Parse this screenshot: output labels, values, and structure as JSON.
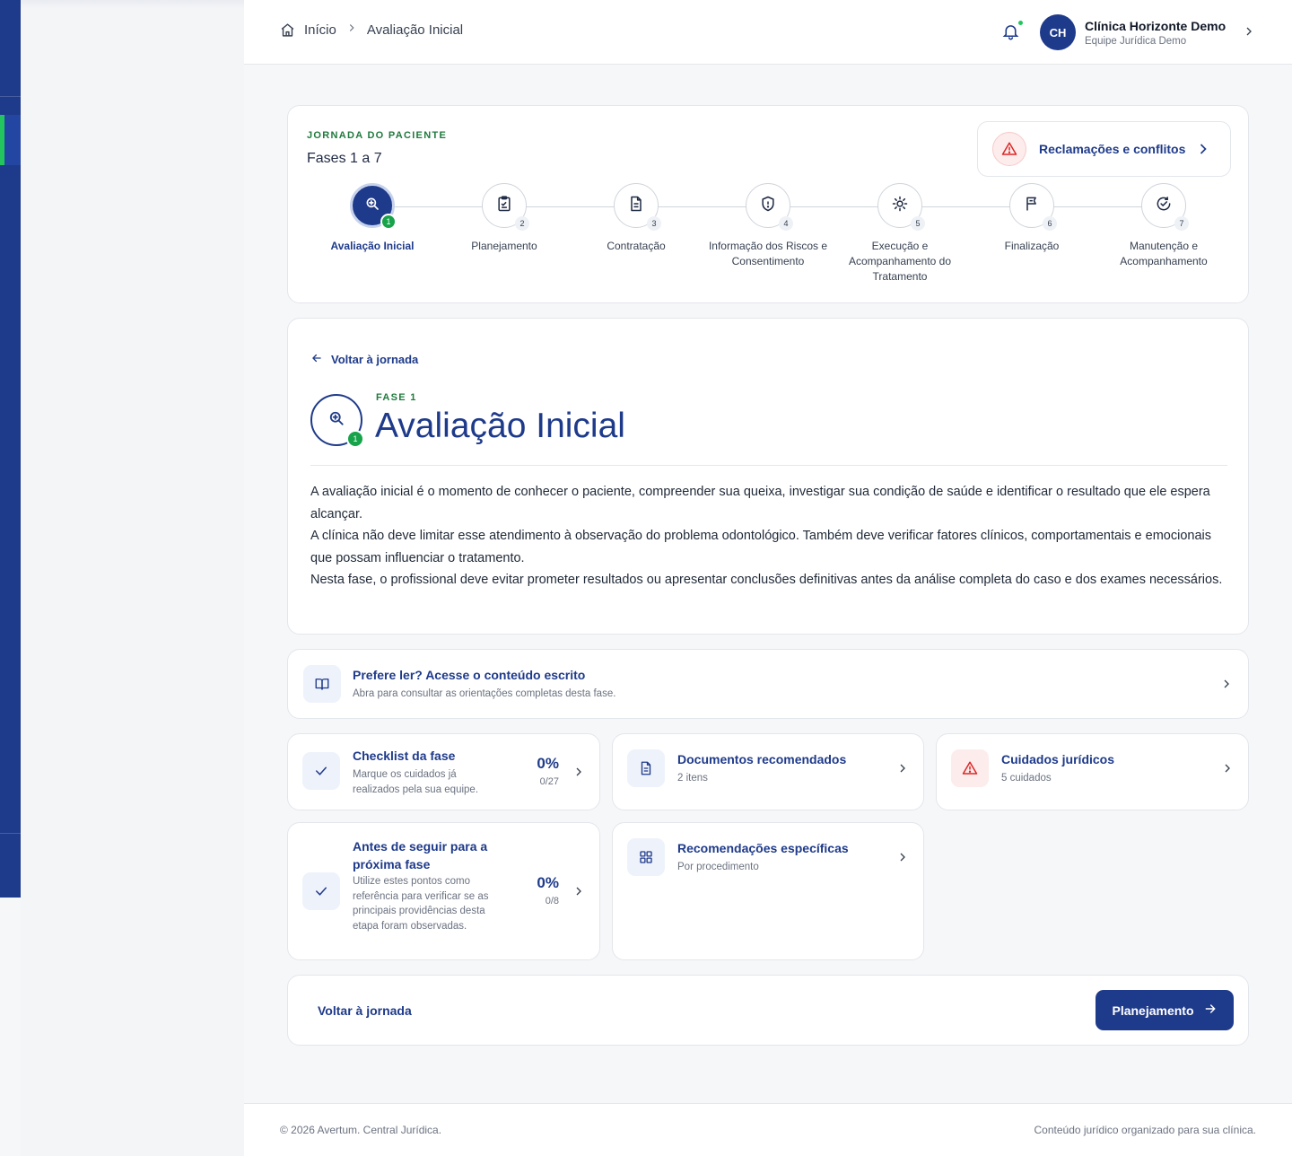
{
  "breadcrumb": {
    "home": "Início",
    "current": "Avaliação Inicial"
  },
  "user": {
    "initials": "CH",
    "name": "Clínica Horizonte Demo",
    "team": "Equipe Jurídica Demo"
  },
  "journey": {
    "eyebrow": "JORNADA DO PACIENTE",
    "subtitle": "Fases 1 a 7",
    "claims_label": "Reclamações e conflitos",
    "steps": [
      {
        "n": "1",
        "label": "Avaliação Inicial",
        "icon": "search-plus-icon"
      },
      {
        "n": "2",
        "label": "Planejamento",
        "icon": "clipboard-check-icon"
      },
      {
        "n": "3",
        "label": "Contratação",
        "icon": "document-icon"
      },
      {
        "n": "4",
        "label": "Informação dos Riscos e Consentimento",
        "icon": "shield-icon"
      },
      {
        "n": "5",
        "label": "Execução e Acompanhamento do Tratamento",
        "icon": "sun-gear-icon"
      },
      {
        "n": "6",
        "label": "Finalização",
        "icon": "flag-icon"
      },
      {
        "n": "7",
        "label": "Manutenção e Acompanhamento",
        "icon": "check-circle-icon"
      }
    ]
  },
  "phase": {
    "back_label": "Voltar à jornada",
    "eyebrow": "FASE 1",
    "number": "1",
    "title": "Avaliação Inicial",
    "paragraphs": [
      "A avaliação inicial é o momento de conhecer o paciente, compreender sua queixa, investigar sua condição de saúde e identificar o resultado que ele espera alcançar.",
      "A clínica não deve limitar esse atendimento à observação do problema odontológico. Também deve verificar fatores clínicos, comportamentais e emocionais que possam influenciar o tratamento.",
      "Nesta fase, o profissional deve evitar prometer resultados ou apresentar conclusões definitivas antes da análise completa do caso e dos exames necessários."
    ]
  },
  "read": {
    "title": "Prefere ler? Acesse o conteúdo escrito",
    "subtitle": "Abra para consultar as orientações completas desta fase."
  },
  "tiles": {
    "checklist": {
      "title": "Checklist da fase",
      "subtitle": "Marque os cuidados já realizados pela sua equipe.",
      "percent": "0%",
      "count": "0/27"
    },
    "documents": {
      "title": "Documentos recomendados",
      "subtitle": "2 itens"
    },
    "legal": {
      "title": "Cuidados jurídicos",
      "subtitle": "5 cuidados"
    },
    "before": {
      "title": "Antes de seguir para a próxima fase",
      "subtitle": "Utilize estes pontos como referência para verificar se as principais providências desta etapa foram observadas.",
      "percent": "0%",
      "count": "0/8"
    },
    "recommendations": {
      "title": "Recomendações específicas",
      "subtitle": "Por procedimento"
    }
  },
  "actions": {
    "back_label": "Voltar à jornada",
    "next_label": "Planejamento"
  },
  "footer": {
    "left": "© 2026 Avertum. Central Jurídica.",
    "right": "Conteúdo jurídico organizado para sua clínica."
  },
  "colors": {
    "primary": "#1e3a8a",
    "success": "#16a34a",
    "eyebrow": "#1f7a3d",
    "danger": "#dc2626"
  }
}
